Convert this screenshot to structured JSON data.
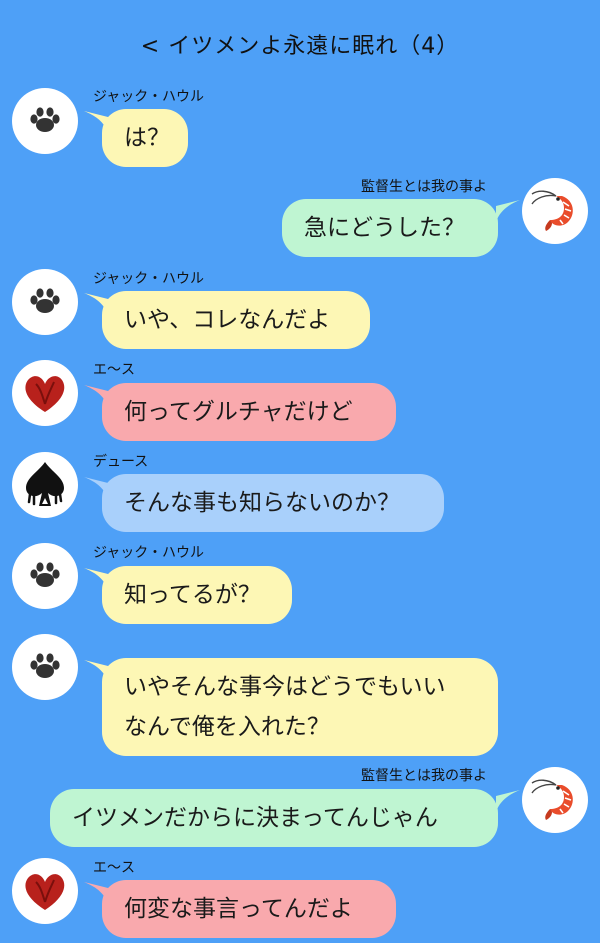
{
  "header": {
    "back": "<",
    "title": "イツメンよ永遠に眠れ（4）"
  },
  "colors": {
    "background": "#4ea0f7",
    "jack": "#fdf7b5",
    "self": "#bff5d2",
    "ace": "#f9a9ad",
    "deuce": "#a9d0fb"
  },
  "messages": [
    {
      "sender": "ジャック・ハウル",
      "avatar": "paw-icon",
      "text": "は？"
    },
    {
      "sender": "監督生とは我の事よ",
      "avatar": "shrimp-icon",
      "text": "急にどうした？"
    },
    {
      "sender": "ジャック・ハウル",
      "avatar": "paw-icon",
      "text": "いや、コレなんだよ"
    },
    {
      "sender": "エ〜ス",
      "avatar": "heart-icon",
      "text": "何ってグルチャだけど"
    },
    {
      "sender": "デュース",
      "avatar": "spade-icon",
      "text": "そんな事も知らないのか？"
    },
    {
      "sender": "ジャック・ハウル",
      "avatar": "paw-icon",
      "text": "知ってるが？"
    },
    {
      "sender": "",
      "avatar": "paw-icon",
      "line1": "いやそんな事今はどうでもいい",
      "line2": "なんで俺を入れた？"
    },
    {
      "sender": "監督生とは我の事よ",
      "avatar": "shrimp-icon",
      "text": "イツメンだからに決まってんじゃん"
    },
    {
      "sender": "エ〜ス",
      "avatar": "heart-icon",
      "text": "何変な事言ってんだよ"
    }
  ]
}
